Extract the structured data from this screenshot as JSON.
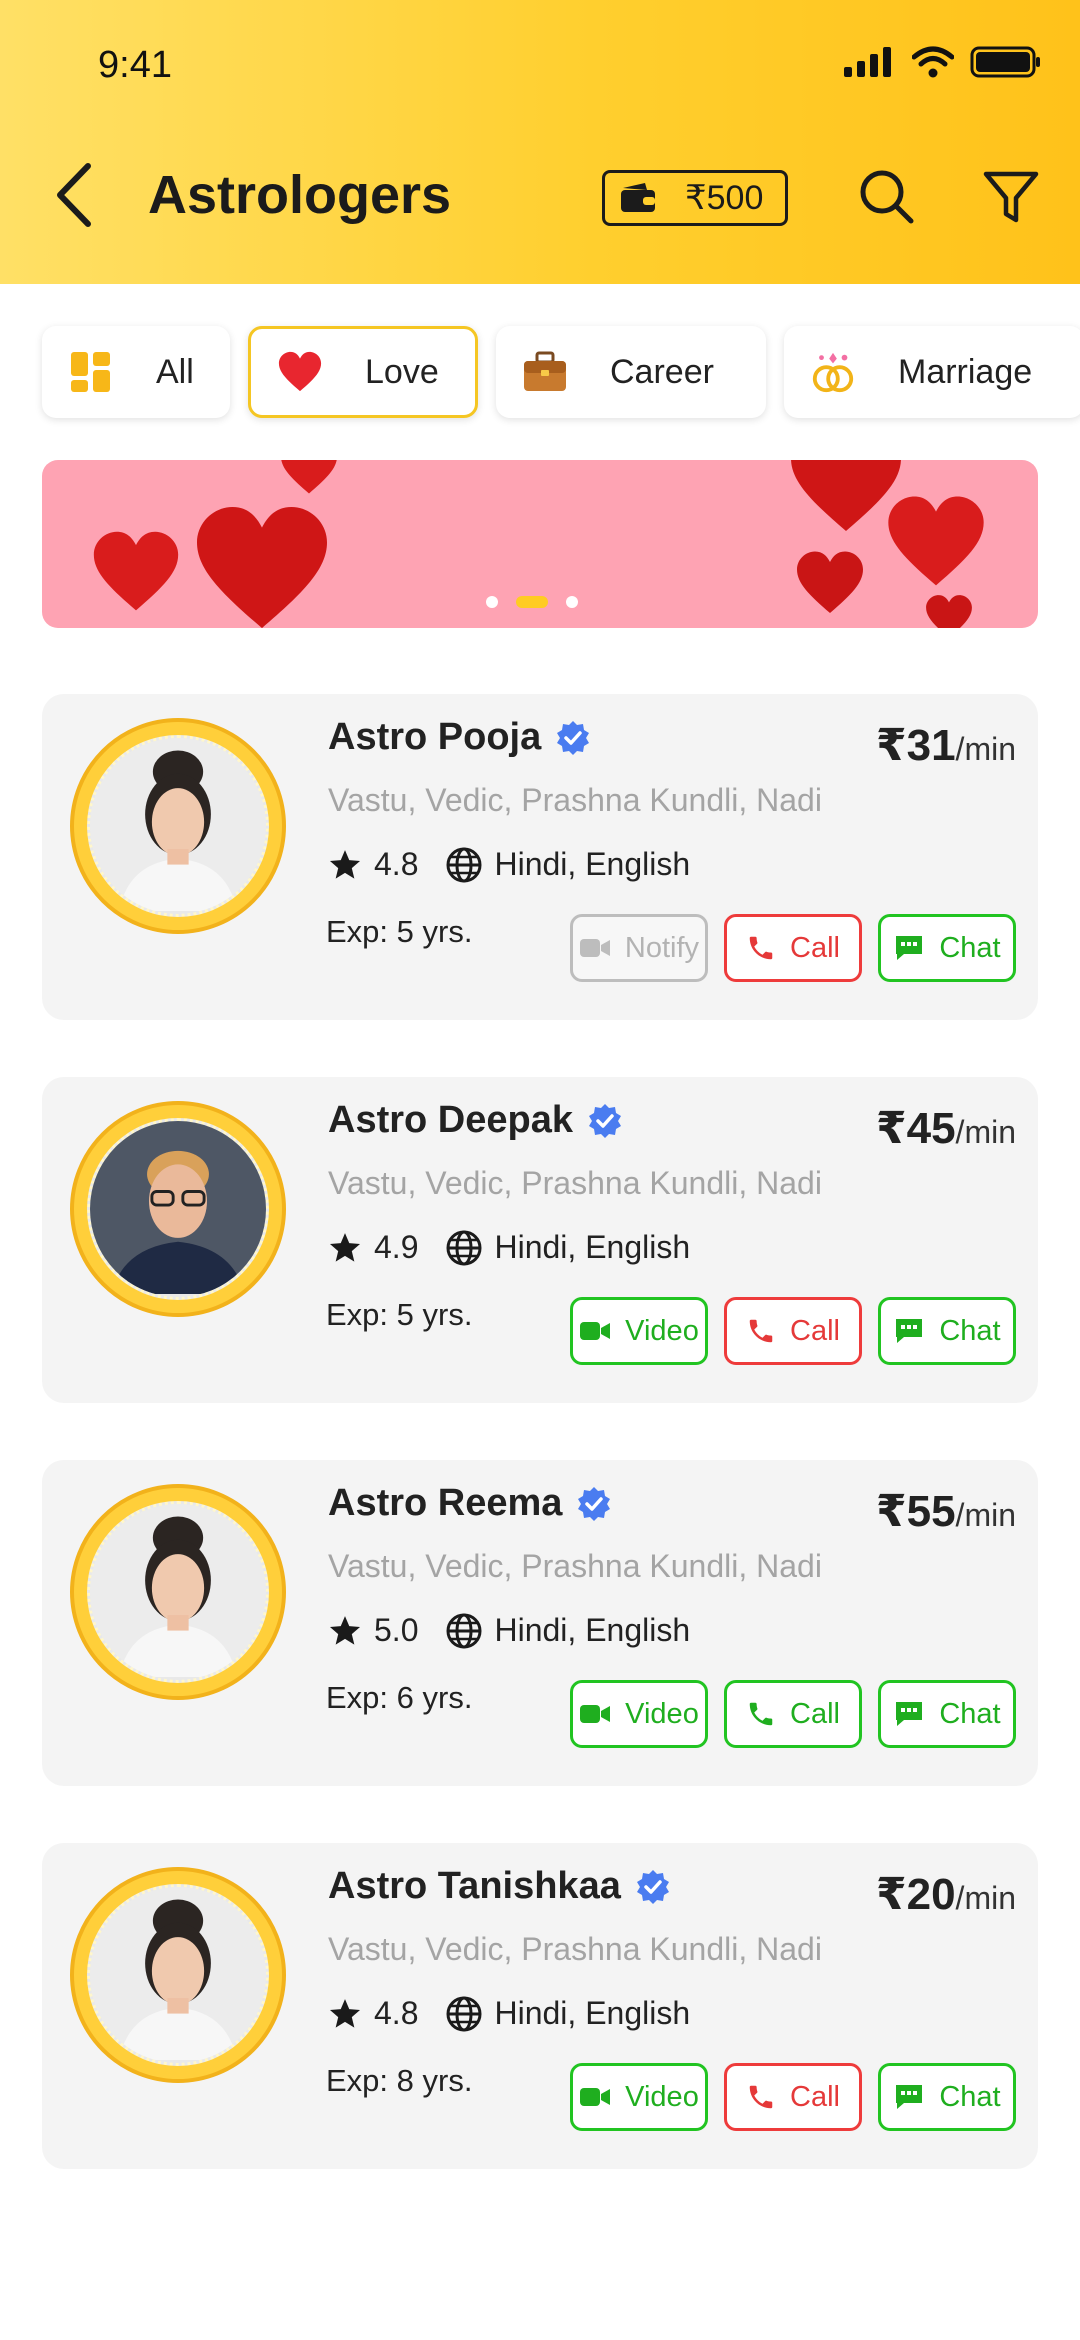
{
  "status_bar": {
    "time": "9:41"
  },
  "header": {
    "title": "Astrologers",
    "wallet_balance": "₹500"
  },
  "categories": [
    {
      "label": "All",
      "icon": "grid-icon",
      "active": false
    },
    {
      "label": "Love",
      "icon": "heart-icon",
      "active": true
    },
    {
      "label": "Career",
      "icon": "briefcase-icon",
      "active": false
    },
    {
      "label": "Marriage",
      "icon": "rings-icon",
      "active": false
    }
  ],
  "banner": {
    "slide_index": 2,
    "slide_count": 3
  },
  "astrologers": [
    {
      "name": "Astro Pooja",
      "price": "₹31",
      "unit": "/min",
      "skills": "Vastu, Vedic, Prashna Kundli, Nadi",
      "rating": "4.8",
      "languages": "Hindi, English",
      "experience": "Exp: 5 yrs.",
      "first_action": "Notify",
      "call_label": "Call",
      "chat_label": "Chat"
    },
    {
      "name": "Astro Deepak",
      "price": "₹45",
      "unit": "/min",
      "skills": "Vastu, Vedic, Prashna Kundli, Nadi",
      "rating": "4.9",
      "languages": "Hindi, English",
      "experience": "Exp: 5 yrs.",
      "first_action": "Video",
      "call_label": "Call",
      "chat_label": "Chat"
    },
    {
      "name": "Astro Reema",
      "price": "₹55",
      "unit": "/min",
      "skills": "Vastu, Vedic, Prashna Kundli, Nadi",
      "rating": "5.0",
      "languages": "Hindi, English",
      "experience": "Exp: 6 yrs.",
      "first_action": "Video",
      "call_label": "Call",
      "chat_label": "Chat"
    },
    {
      "name": "Astro Tanishkaa",
      "price": "₹20",
      "unit": "/min",
      "skills": "Vastu, Vedic, Prashna Kundli, Nadi",
      "rating": "4.8",
      "languages": "Hindi, English",
      "experience": "Exp: 8 yrs.",
      "first_action": "Video",
      "call_label": "Call",
      "chat_label": "Chat"
    }
  ],
  "colors": {
    "header_yellow": "#ffcf2e",
    "active_chip_border": "#f5c623",
    "green": "#21c421",
    "red": "#ee3b3b",
    "verified_blue": "#4a7cf0",
    "banner_pink": "#fea3b3"
  }
}
